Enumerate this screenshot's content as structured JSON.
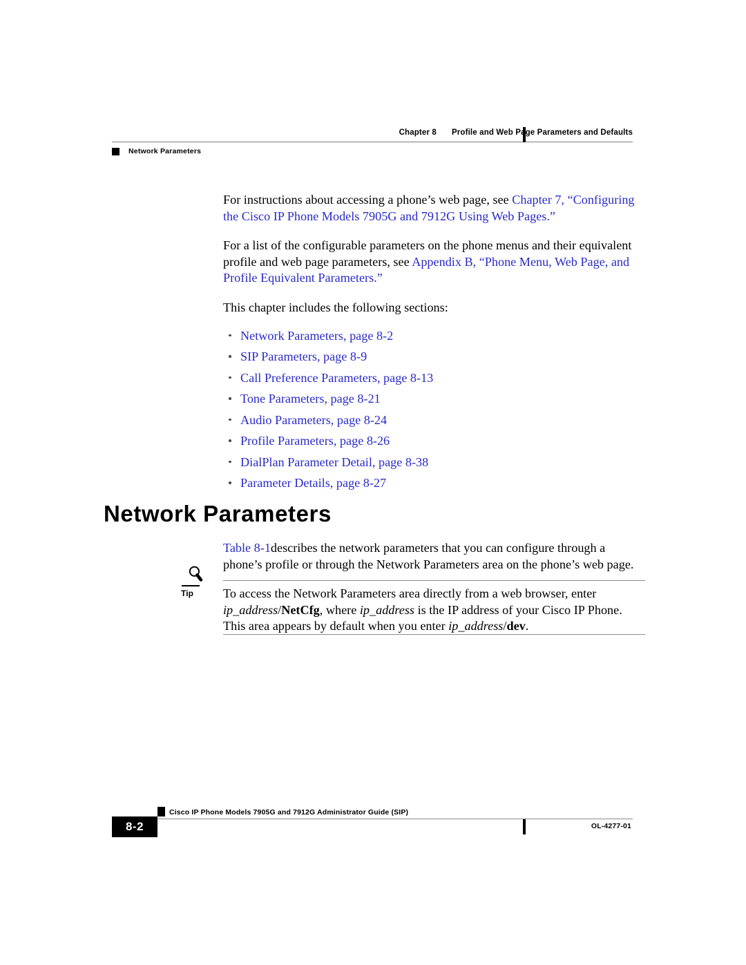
{
  "header": {
    "chapter_number": "Chapter 8",
    "chapter_title": "Profile and Web Page Parameters and Defaults",
    "section_label": "Network Parameters"
  },
  "body": {
    "para1": {
      "text_before": "For instructions about accessing a phone’s web page, see ",
      "link": "Chapter 7, “Configuring the Cisco IP Phone Models 7905G and 7912G Using Web Pages.”"
    },
    "para2": {
      "text_before": "For a list of the configurable parameters on the phone menus and their equivalent profile and web page parameters, see ",
      "link": "Appendix B, “Phone Menu, Web Page, and Profile Equivalent Parameters.”"
    },
    "para3": "This chapter includes the following sections:",
    "sections": [
      "Network Parameters, page 8-2",
      "SIP Parameters, page 8-9",
      "Call Preference Parameters, page 8-13",
      "Tone Parameters, page 8-21",
      "Audio Parameters, page 8-24",
      "Profile Parameters, page 8-26",
      "DialPlan Parameter Detail, page 8-38",
      "Parameter Details, page 8-27"
    ]
  },
  "section": {
    "heading": "Network Parameters",
    "intro": {
      "link": "Table 8-1",
      "text_after": "describes the network parameters that you can configure through a phone’s profile or through the Network Parameters area on the phone’s web page."
    }
  },
  "tip": {
    "label": "Tip",
    "icon": "magnifying-glass-icon",
    "line1": "To access the Network Parameters area directly from a web browser, enter ",
    "ip_address_1": "ip_address",
    "netcfg": "NetCfg",
    "line2_mid": ", where ",
    "ip_address_2": "ip_address",
    "line2_end": " is the IP address of your Cisco IP Phone. This area appears by default when you enter ",
    "ip_address_3": "ip_address",
    "dev": "dev",
    "period": "."
  },
  "footer": {
    "guide_title": "Cisco IP Phone Models 7905G and 7912G Administrator Guide (SIP)",
    "page_number": "8-2",
    "doc_id": "OL-4277-01"
  },
  "colors": {
    "link_blue": "#2a2ac8",
    "text_black": "#000000",
    "rule_gray": "#8a8a8a"
  }
}
